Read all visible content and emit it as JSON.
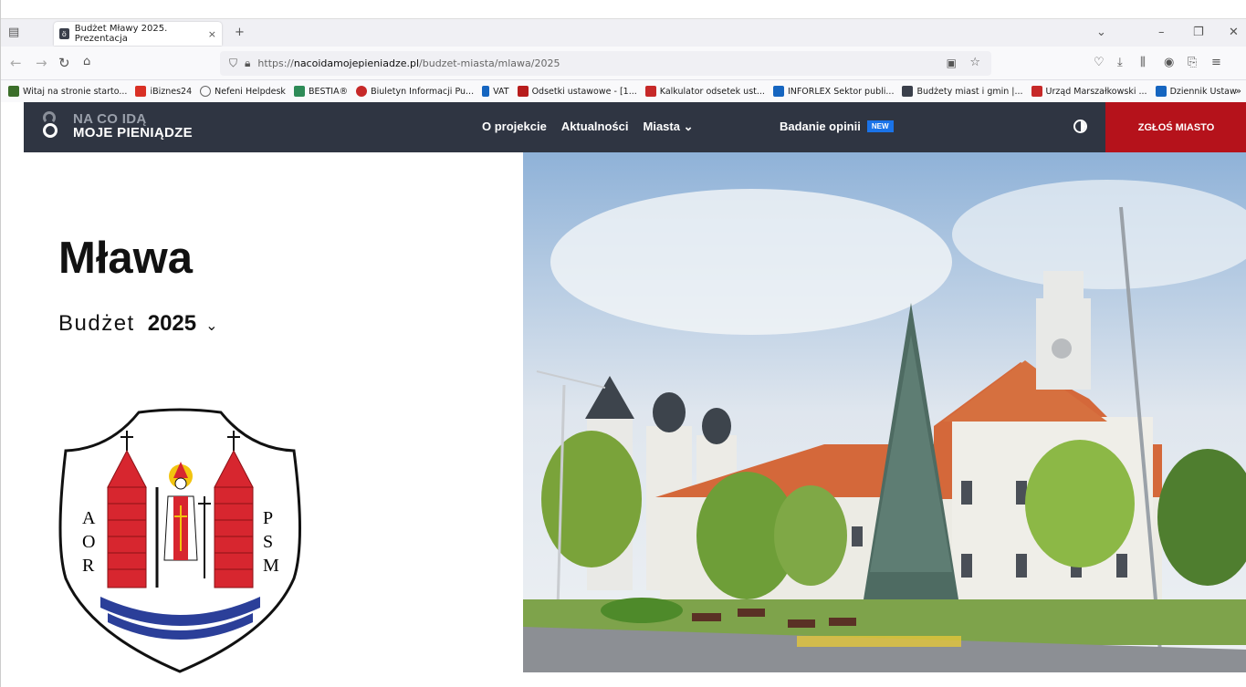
{
  "browser": {
    "tab_title": "Budżet Mławy 2025. Prezentacja",
    "url_prefix": "https://",
    "url_host": "nacoidamojepieniadze.pl",
    "url_path": "/budzet-miasta/mlawa/2025",
    "bookmarks": [
      {
        "label": "Witaj na stronie starto...",
        "color": "#3b6e2a"
      },
      {
        "label": "iBiznes24",
        "color": "#d93025"
      },
      {
        "label": "Nefeni Helpdesk",
        "color": "#666666"
      },
      {
        "label": "BESTIA®",
        "color": "#2e8b57"
      },
      {
        "label": "Biuletyn Informacji Pu...",
        "color": "#c62828"
      },
      {
        "label": "VAT",
        "color": "#1565c0"
      },
      {
        "label": "Odsetki ustawowe - [1...",
        "color": "#b71c1c"
      },
      {
        "label": "Kalkulator odsetek ust...",
        "color": "#c62828"
      },
      {
        "label": "INFORLEX Sektor publi...",
        "color": "#1565c0"
      },
      {
        "label": "Budżety miast i gmin |...",
        "color": "#3a3f4b"
      },
      {
        "label": "Urząd Marszałkowski ...",
        "color": "#c62828"
      },
      {
        "label": "Dziennik Ustaw",
        "color": "#1565c0"
      }
    ]
  },
  "site": {
    "logo_line1": "NA CO IDĄ",
    "logo_line2": "MOJE PIENIĄDZE",
    "menu": [
      "O projekcie",
      "Aktualności",
      "Miasta ⌄"
    ],
    "survey_label": "Badanie opinii",
    "survey_badge": "NEW",
    "report_button": "ZGŁOŚ MIASTO"
  },
  "hero": {
    "city": "Mława",
    "budget_label": "Budżet",
    "budget_year": "2025",
    "coat_letters_left": [
      "A",
      "O",
      "R"
    ],
    "coat_letters_right": [
      "P",
      "S",
      "M"
    ]
  }
}
